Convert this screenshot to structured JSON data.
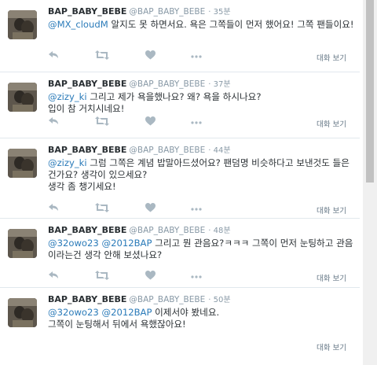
{
  "tweets": [
    {
      "name": "BAP_BABY_BEBE",
      "handle": "@BAP_BABY_BEBE",
      "time": "· 35분",
      "mentions": [
        "@MX_cloudM"
      ],
      "text": " 알지도 못 하면서요. 욕은 그쪽들이 먼저 했어요! 그쪽 팬들이요!",
      "conversation_label": "대화 보기"
    },
    {
      "name": "BAP_BABY_BEBE",
      "handle": "@BAP_BABY_BEBE",
      "time": "· 37분",
      "mentions": [
        "@zizy_ki"
      ],
      "text": " 그리고 제가 욕을했나요? 왜? 욕을 하시나요?\n입이 참 거치시네요!",
      "conversation_label": "대화 보기"
    },
    {
      "name": "BAP_BABY_BEBE",
      "handle": "@BAP_BABY_BEBE",
      "time": "· 44분",
      "mentions": [
        "@zizy_ki"
      ],
      "text": " 그럼 그쪽은 계념 밥말아드셨어요? 팬덤명 비슷하다고 보낸것도 들은건가요? 생각이 있으세요?\n생각 좀 챙기세요!",
      "conversation_label": "대화 보기"
    },
    {
      "name": "BAP_BABY_BEBE",
      "handle": "@BAP_BABY_BEBE",
      "time": "· 48분",
      "mentions": [
        "@32owo23",
        "@2012BAP"
      ],
      "text": " 그리고 뭔 관음요?ㅋㅋㅋ 그쪽이 먼저 눈팅하고 관음이라는건 생각 안해 보셨나요?",
      "conversation_label": "대화 보기"
    },
    {
      "name": "BAP_BABY_BEBE",
      "handle": "@BAP_BABY_BEBE",
      "time": "· 50분",
      "mentions": [
        "@32owo23",
        "@2012BAP"
      ],
      "text": " 이제서야 봤네요.\n그쪽이 눈팅해서 뒤에서 욕했잖아요!",
      "conversation_label": "대화 보기"
    }
  ],
  "colors": {
    "mention": "#2b7bb9",
    "meta": "#8899a6",
    "text": "#292f33",
    "action_icon": "#aab8c2",
    "divider": "#e1e8ed"
  },
  "icons": [
    "reply-icon",
    "retweet-icon",
    "like-icon",
    "more-icon"
  ]
}
